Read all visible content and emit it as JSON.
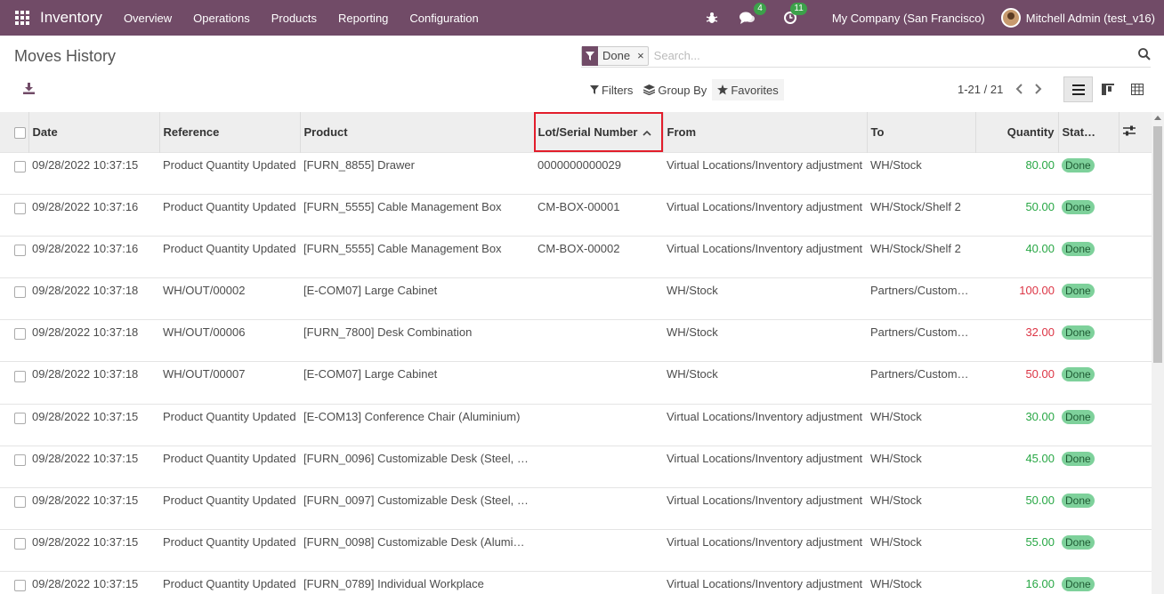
{
  "navbar": {
    "app_name": "Inventory",
    "menu": [
      "Overview",
      "Operations",
      "Products",
      "Reporting",
      "Configuration"
    ],
    "chat_count": "4",
    "activity_count": "11",
    "company": "My Company (San Francisco)",
    "user": "Mitchell Admin (test_v16)"
  },
  "page": {
    "title": "Moves History"
  },
  "search": {
    "facet_label": "Done",
    "facet_remove": "×",
    "placeholder": "Search..."
  },
  "toolbar": {
    "filters_label": "Filters",
    "group_by_label": "Group By",
    "favorites_label": "Favorites",
    "pager_value": "1-21 / 21"
  },
  "table": {
    "columns": [
      "Date",
      "Reference",
      "Product",
      "Lot/Serial Number",
      "From",
      "To",
      "Quantity",
      "Stat…"
    ],
    "rows": [
      {
        "date": "09/28/2022 10:37:15",
        "reference": "Product Quantity Updated",
        "product": "[FURN_8855] Drawer",
        "lot": "0000000000029",
        "from": "Virtual Locations/Inventory adjustment",
        "to": "WH/Stock",
        "quantity": "80.00",
        "qty_sign": "pos",
        "status": "Done"
      },
      {
        "date": "09/28/2022 10:37:16",
        "reference": "Product Quantity Updated",
        "product": "[FURN_5555] Cable Management Box",
        "lot": "CM-BOX-00001",
        "from": "Virtual Locations/Inventory adjustment",
        "to": "WH/Stock/Shelf 2",
        "quantity": "50.00",
        "qty_sign": "pos",
        "status": "Done"
      },
      {
        "date": "09/28/2022 10:37:16",
        "reference": "Product Quantity Updated",
        "product": "[FURN_5555] Cable Management Box",
        "lot": "CM-BOX-00002",
        "from": "Virtual Locations/Inventory adjustment",
        "to": "WH/Stock/Shelf 2",
        "quantity": "40.00",
        "qty_sign": "pos",
        "status": "Done"
      },
      {
        "date": "09/28/2022 10:37:18",
        "reference": "WH/OUT/00002",
        "product": "[E-COM07] Large Cabinet",
        "lot": "",
        "from": "WH/Stock",
        "to": "Partners/Customers",
        "quantity": "100.00",
        "qty_sign": "neg",
        "status": "Done"
      },
      {
        "date": "09/28/2022 10:37:18",
        "reference": "WH/OUT/00006",
        "product": "[FURN_7800] Desk Combination",
        "lot": "",
        "from": "WH/Stock",
        "to": "Partners/Customers",
        "quantity": "32.00",
        "qty_sign": "neg",
        "status": "Done"
      },
      {
        "date": "09/28/2022 10:37:18",
        "reference": "WH/OUT/00007",
        "product": "[E-COM07] Large Cabinet",
        "lot": "",
        "from": "WH/Stock",
        "to": "Partners/Customers",
        "quantity": "50.00",
        "qty_sign": "neg",
        "status": "Done"
      },
      {
        "date": "09/28/2022 10:37:15",
        "reference": "Product Quantity Updated",
        "product": "[E-COM13] Conference Chair (Aluminium)",
        "lot": "",
        "from": "Virtual Locations/Inventory adjustment",
        "to": "WH/Stock",
        "quantity": "30.00",
        "qty_sign": "pos",
        "status": "Done"
      },
      {
        "date": "09/28/2022 10:37:15",
        "reference": "Product Quantity Updated",
        "product": "[FURN_0096] Customizable Desk (Steel, …",
        "lot": "",
        "from": "Virtual Locations/Inventory adjustment",
        "to": "WH/Stock",
        "quantity": "45.00",
        "qty_sign": "pos",
        "status": "Done"
      },
      {
        "date": "09/28/2022 10:37:15",
        "reference": "Product Quantity Updated",
        "product": "[FURN_0097] Customizable Desk (Steel, …",
        "lot": "",
        "from": "Virtual Locations/Inventory adjustment",
        "to": "WH/Stock",
        "quantity": "50.00",
        "qty_sign": "pos",
        "status": "Done"
      },
      {
        "date": "09/28/2022 10:37:15",
        "reference": "Product Quantity Updated",
        "product": "[FURN_0098] Customizable Desk (Alumin…",
        "lot": "",
        "from": "Virtual Locations/Inventory adjustment",
        "to": "WH/Stock",
        "quantity": "55.00",
        "qty_sign": "pos",
        "status": "Done"
      },
      {
        "date": "09/28/2022 10:37:15",
        "reference": "Product Quantity Updated",
        "product": "[FURN_0789] Individual Workplace",
        "lot": "",
        "from": "Virtual Locations/Inventory adjustment",
        "to": "WH/Stock",
        "quantity": "16.00",
        "qty_sign": "pos",
        "status": "Done"
      }
    ]
  },
  "colors": {
    "brand": "#714b67",
    "badge": "#3ca14a",
    "qty_positive": "#28a745",
    "qty_negative": "#dc3545",
    "status_done": "#7ed19b",
    "highlight": "#e21d2b"
  }
}
